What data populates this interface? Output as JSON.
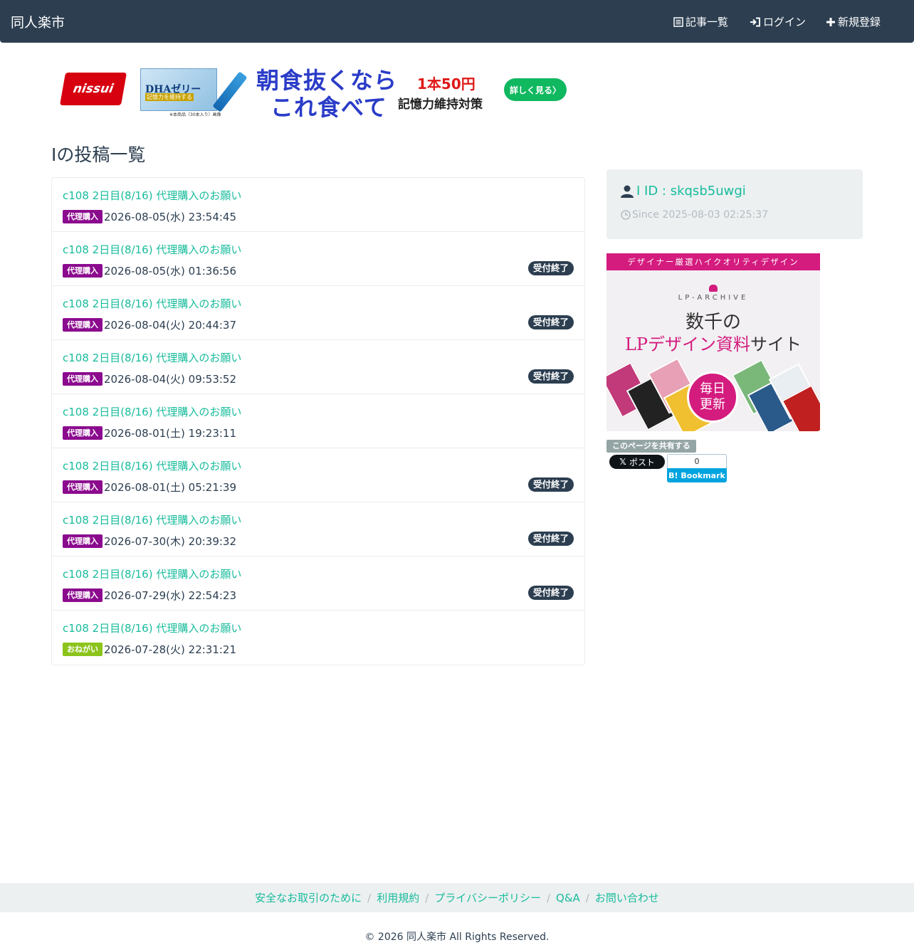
{
  "navbar": {
    "brand": "同人楽市",
    "articles_label": "記事一覧",
    "login_label": "ログイン",
    "register_label": "新規登録"
  },
  "ad": {
    "logo_text": "nissui",
    "product_name": "DHAゼリー",
    "product_claim": "記憶力を維持する",
    "product_note": "※本商品（30本入り）画像",
    "headline_1": "朝食抜くなら",
    "headline_2": "これ食べて",
    "price": "1本50円",
    "sub": "記憶力維持対策",
    "cta": "詳しく見る〉"
  },
  "page_title": "Iの投稿一覧",
  "posts": [
    {
      "title": "c108 2日目(8/16) 代理購入のお願い",
      "label": "代理購入",
      "label_type": "purple",
      "date": "2026-08-05(水) 23:54:45",
      "status": ""
    },
    {
      "title": "c108 2日目(8/16) 代理購入のお願い",
      "label": "代理購入",
      "label_type": "purple",
      "date": "2026-08-05(水) 01:36:56",
      "status": "受付終了"
    },
    {
      "title": "c108 2日目(8/16) 代理購入のお願い",
      "label": "代理購入",
      "label_type": "purple",
      "date": "2026-08-04(火) 20:44:37",
      "status": "受付終了"
    },
    {
      "title": "c108 2日目(8/16) 代理購入のお願い",
      "label": "代理購入",
      "label_type": "purple",
      "date": "2026-08-04(火) 09:53:52",
      "status": "受付終了"
    },
    {
      "title": "c108 2日目(8/16) 代理購入のお願い",
      "label": "代理購入",
      "label_type": "purple",
      "date": "2026-08-01(土) 19:23:11",
      "status": ""
    },
    {
      "title": "c108 2日目(8/16) 代理購入のお願い",
      "label": "代理購入",
      "label_type": "purple",
      "date": "2026-08-01(土) 05:21:39",
      "status": "受付終了"
    },
    {
      "title": "c108 2日目(8/16) 代理購入のお願い",
      "label": "代理購入",
      "label_type": "purple",
      "date": "2026-07-30(木) 20:39:32",
      "status": "受付終了"
    },
    {
      "title": "c108 2日目(8/16) 代理購入のお願い",
      "label": "代理購入",
      "label_type": "purple",
      "date": "2026-07-29(水) 22:54:23",
      "status": "受付終了"
    },
    {
      "title": "c108 2日目(8/16) 代理購入のお願い",
      "label": "おねがい",
      "label_type": "green",
      "date": "2026-07-28(火) 22:31:21",
      "status": ""
    }
  ],
  "profile": {
    "id_text": "I ID : skqsb5uwgi",
    "since_text": "Since 2025-08-03 02:25:37"
  },
  "lp_ad": {
    "top_text": "デザイナー厳選ハイクオリティデザイン",
    "brand": "LP-ARCHIVE",
    "main_1": "数千の",
    "main_2_a": "LPデザイン",
    "main_2_b": "資料",
    "main_2_c": "サイト",
    "badge_1": "毎日",
    "badge_2": "更新"
  },
  "share": {
    "label": "このページを共有する",
    "x_post": "ポスト",
    "hatena_count": "0",
    "hatena_label": "B! Bookmark"
  },
  "footer": {
    "links": [
      "安全なお取引のために",
      "利用規約",
      "プライバシーポリシー",
      "Q&A",
      "お問い合わせ"
    ],
    "copyright": "© 2026 同人楽市 All Rights Reserved."
  },
  "colors": {
    "navbar": "#2c3e50",
    "link": "#18bc9c",
    "label_purple": "#8b0a8e",
    "label_green": "#8cc41c",
    "panel": "#ecf0f1"
  }
}
